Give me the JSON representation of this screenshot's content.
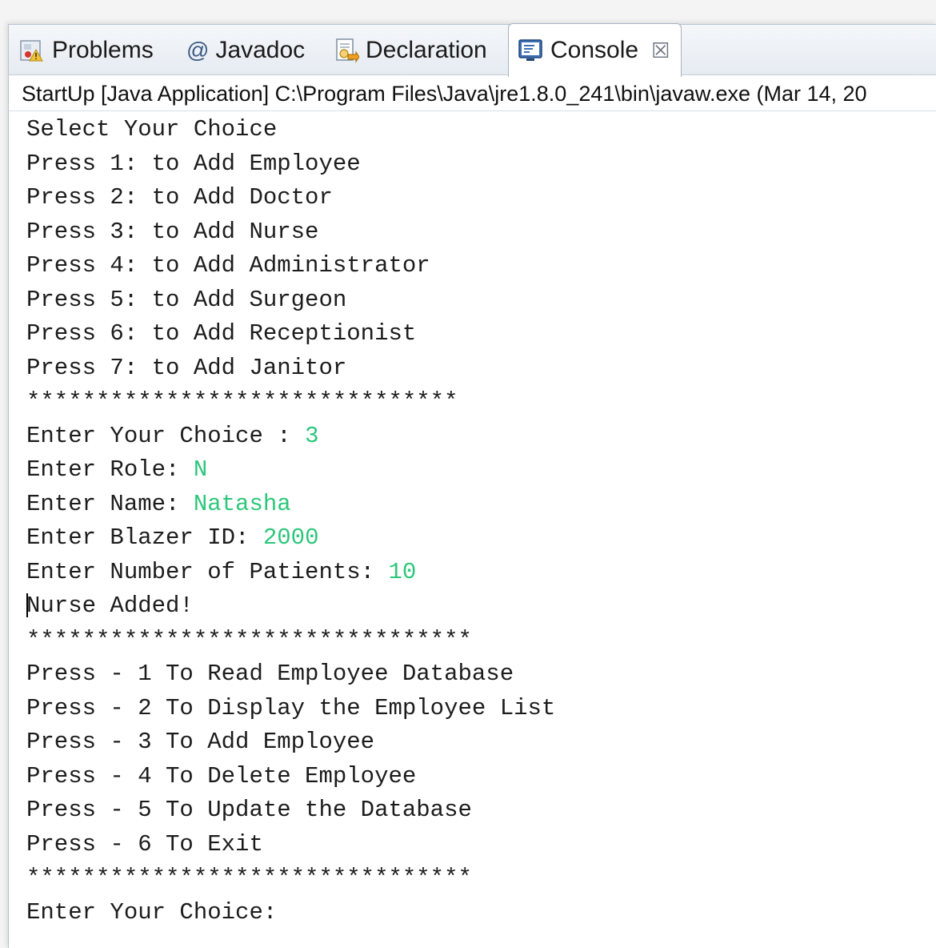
{
  "tabs": [
    {
      "label": "Problems",
      "icon": "problems-icon"
    },
    {
      "label": "Javadoc",
      "icon": "at-icon"
    },
    {
      "label": "Declaration",
      "icon": "declaration-icon"
    },
    {
      "label": "Console",
      "icon": "console-icon",
      "active": true
    }
  ],
  "launch_info": "StartUp [Java Application] C:\\Program Files\\Java\\jre1.8.0_241\\bin\\javaw.exe (Mar 14, 20",
  "console": {
    "menu1": [
      "Select Your Choice",
      "Press 1: to Add Employee",
      "Press 2: to Add Doctor",
      "Press 3: to Add Nurse",
      "Press 4: to Add Administrator",
      "Press 5: to Add Surgeon",
      "Press 6: to Add Receptionist",
      "Press 7: to Add Janitor"
    ],
    "separator1": "*******************************",
    "prompts": [
      {
        "label": "Enter Your Choice : ",
        "value": "3"
      },
      {
        "label": "Enter Role: ",
        "value": "N"
      },
      {
        "label": "Enter Name: ",
        "value": "Natasha"
      },
      {
        "label": "Enter Blazer ID: ",
        "value": "2000"
      },
      {
        "label": "Enter Number of Patients: ",
        "value": "10"
      }
    ],
    "result_first_char": "N",
    "result_rest": "urse Added!",
    "separator2": "********************************",
    "menu2": [
      "Press - 1 To Read Employee Database",
      "Press - 2 To Display the Employee List",
      "Press - 3 To Add Employee",
      "Press - 4 To Delete Employee",
      "Press - 5 To Update the Database",
      "Press - 6 To Exit"
    ],
    "separator3": "********************************",
    "final_prompt": "Enter Your Choice:"
  },
  "colors": {
    "input_text": "#2cc77a",
    "console_text": "#1c1c1c"
  }
}
